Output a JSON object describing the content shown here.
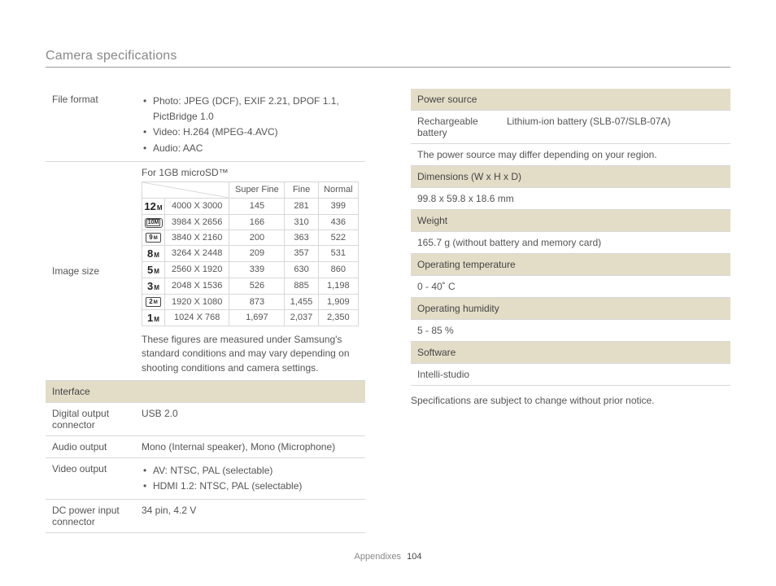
{
  "page_title": "Camera specifications",
  "left": {
    "file_format": {
      "label": "File format",
      "items": [
        "Photo: JPEG (DCF), EXIF 2.21, DPOF 1.1, PictBridge 1.0",
        "Video: H.264 (MPEG-4.AVC)",
        "Audio: AAC"
      ]
    },
    "image_size": {
      "label": "Image size",
      "for_text": "For 1GB microSD™",
      "cols": {
        "c1": "Super Fine",
        "c2": "Fine",
        "c3": "Normal"
      },
      "rows": [
        {
          "icon": {
            "type": "plain",
            "n": "12"
          },
          "res": "4000 X 3000",
          "v": [
            "145",
            "281",
            "399"
          ]
        },
        {
          "icon": {
            "type": "frame",
            "n": "10"
          },
          "res": "3984 X 2656",
          "v": [
            "166",
            "310",
            "436"
          ]
        },
        {
          "icon": {
            "type": "box",
            "n": "9"
          },
          "res": "3840 X 2160",
          "v": [
            "200",
            "363",
            "522"
          ]
        },
        {
          "icon": {
            "type": "plain",
            "n": "8"
          },
          "res": "3264 X 2448",
          "v": [
            "209",
            "357",
            "531"
          ]
        },
        {
          "icon": {
            "type": "plain",
            "n": "5"
          },
          "res": "2560 X 1920",
          "v": [
            "339",
            "630",
            "860"
          ]
        },
        {
          "icon": {
            "type": "plain",
            "n": "3"
          },
          "res": "2048 X 1536",
          "v": [
            "526",
            "885",
            "1,198"
          ]
        },
        {
          "icon": {
            "type": "box",
            "n": "2"
          },
          "res": "1920 X 1080",
          "v": [
            "873",
            "1,455",
            "1,909"
          ]
        },
        {
          "icon": {
            "type": "plain",
            "n": "1"
          },
          "res": "1024 X 768",
          "v": [
            "1,697",
            "2,037",
            "2,350"
          ]
        }
      ],
      "note": "These figures are measured under Samsung's standard conditions and may vary depending on shooting conditions and camera settings."
    },
    "interface": {
      "header": "Interface",
      "rows": [
        {
          "label": "Digital output connector",
          "value": "USB 2.0"
        },
        {
          "label": "Audio output",
          "value": "Mono (Internal speaker), Mono (Microphone)"
        },
        {
          "label": "Video output",
          "bullets": [
            "AV: NTSC, PAL (selectable)",
            "HDMI 1.2: NTSC, PAL (selectable)"
          ]
        },
        {
          "label": "DC power input connector",
          "value": "34 pin, 4.2 V"
        }
      ]
    }
  },
  "right": {
    "sections": [
      {
        "header": "Power source",
        "rows": [
          {
            "label": "Rechargeable battery",
            "value": "Lithium-ion battery (SLB-07/SLB-07A)"
          },
          {
            "full": "The power source may differ depending on your region."
          }
        ]
      },
      {
        "header": "Dimensions (W x H x D)",
        "rows": [
          {
            "full": "99.8 x 59.8 x 18.6 mm"
          }
        ]
      },
      {
        "header": "Weight",
        "rows": [
          {
            "full": "165.7 g (without battery and memory card)"
          }
        ]
      },
      {
        "header": "Operating temperature",
        "rows": [
          {
            "full": "0 - 40˚ C"
          }
        ]
      },
      {
        "header": "Operating humidity",
        "rows": [
          {
            "full": "5 - 85 %"
          }
        ]
      },
      {
        "header": "Software",
        "rows": [
          {
            "full": "Intelli-studio"
          }
        ]
      }
    ],
    "footnote": "Specifications are subject to change without prior notice."
  },
  "footer": {
    "section": "Appendixes",
    "page": "104"
  }
}
